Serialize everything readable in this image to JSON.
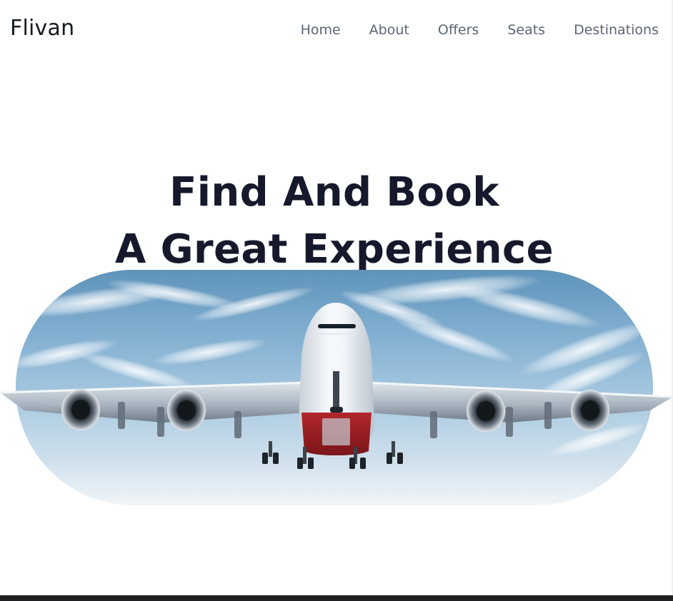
{
  "brand": {
    "name": "Flivan"
  },
  "nav": {
    "items": [
      {
        "label": "Home"
      },
      {
        "label": "About"
      },
      {
        "label": "Offers"
      },
      {
        "label": "Seats"
      },
      {
        "label": "Destinations"
      }
    ]
  },
  "hero": {
    "title_line1": "Find And Book",
    "title_line2": "A Great Experience"
  },
  "colors": {
    "heading": "#16192b",
    "nav_text": "#5d6576",
    "sky_top": "#6f9fc4",
    "sky_bottom": "#ecf2f7",
    "plane_body": "#e9edf1",
    "plane_accent": "#9d1f24"
  }
}
